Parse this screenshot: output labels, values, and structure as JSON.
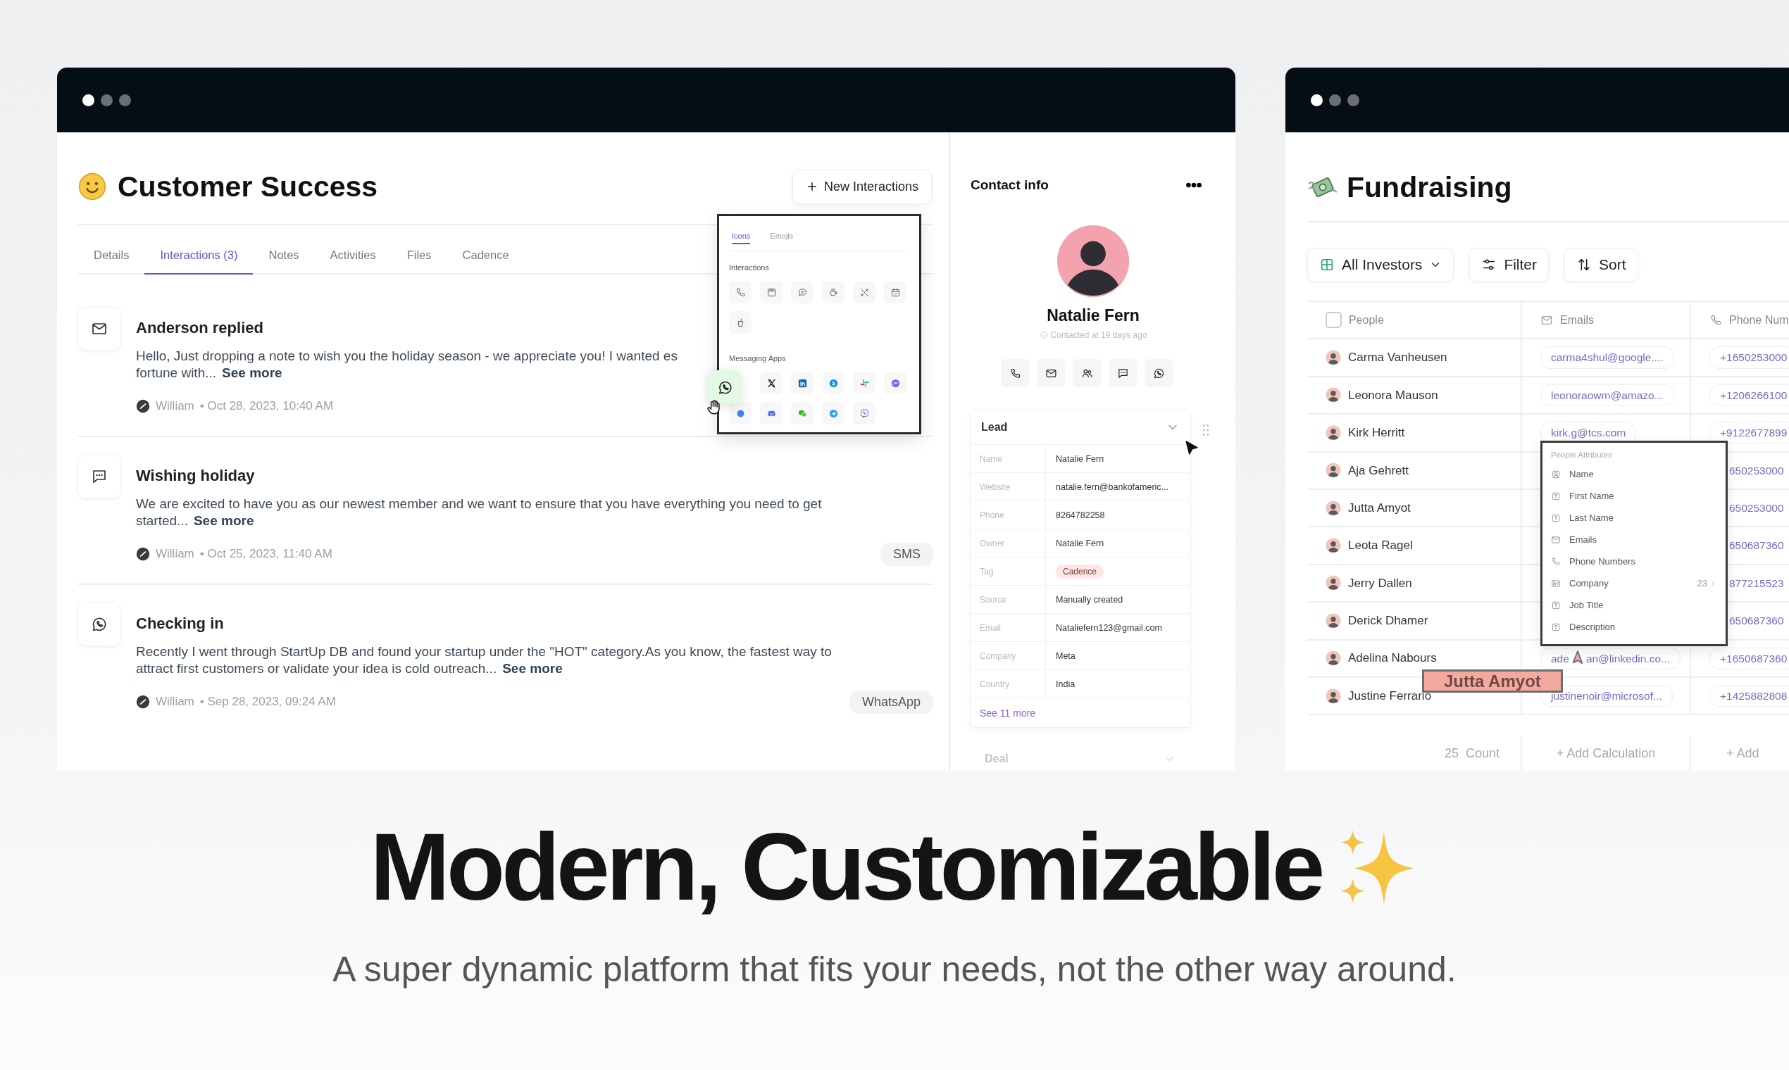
{
  "support_window": {
    "title": "Customer Success",
    "new_button": "New Interactions",
    "tabs": [
      {
        "label": "Details",
        "selected": false
      },
      {
        "label": "Interactions (3)",
        "selected": true
      },
      {
        "label": "Notes",
        "selected": false
      },
      {
        "label": "Activities",
        "selected": false
      },
      {
        "label": "Files",
        "selected": false
      },
      {
        "label": "Cadence",
        "selected": false
      }
    ],
    "interactions": [
      {
        "kind": "email",
        "title": "Anderson replied",
        "lines": [
          "Hello, Just dropping a note to wish you the holiday season - we appreciate you!  I wanted es",
          "fortune with..."
        ],
        "see_more": "See more",
        "author": "William",
        "date": "• Oct 28, 2023, 10:40 AM"
      },
      {
        "kind": "message",
        "title": "Wishing holiday",
        "lines": [
          "We are excited to have you as our newest member and we want to ensure that you have everything you need to get",
          "started..."
        ],
        "see_more": "See more",
        "author": "William",
        "date": "• Oct 25, 2023, 11:40 AM",
        "channel": "SMS"
      },
      {
        "kind": "whatsapp",
        "title": "Checking in",
        "lines": [
          "Recently I went through StartUp DB and found your startup under the \"HOT\" category.As you know, the fastest way to",
          "attract first customers or validate your idea is cold outreach..."
        ],
        "see_more": "See more",
        "author": "William",
        "date": "• Sep 28, 2023, 09:24 AM",
        "channel": "WhatsApp"
      }
    ],
    "icon_picker": {
      "tabs": [
        {
          "label": "Icons",
          "selected": true
        },
        {
          "label": "Emojis",
          "selected": false
        }
      ],
      "sections": [
        {
          "title": "Interactions",
          "icons": [
            {
              "kind": "phone",
              "dragging": false
            },
            {
              "kind": "window",
              "dragging": false
            },
            {
              "kind": "speech",
              "dragging": false
            },
            {
              "kind": "coffee",
              "dragging": false
            },
            {
              "kind": "utensils",
              "dragging": false
            },
            {
              "kind": "calendar",
              "dragging": false
            },
            {
              "kind": "cup",
              "dragging": false
            }
          ]
        },
        {
          "title": "Messaging Apps",
          "icons": [
            {
              "kind": "whatsapp",
              "dragging": true
            },
            {
              "kind": "xlogo",
              "dragging": false
            },
            {
              "kind": "linkedin",
              "dragging": false
            },
            {
              "kind": "skype",
              "dragging": false
            },
            {
              "kind": "slack",
              "dragging": false
            },
            {
              "kind": "messenger",
              "dragging": false
            },
            {
              "kind": "bubble",
              "dragging": false
            },
            {
              "kind": "discord",
              "dragging": false
            },
            {
              "kind": "wechat",
              "dragging": false
            },
            {
              "kind": "telegram",
              "dragging": false
            },
            {
              "kind": "viber",
              "dragging": false
            }
          ]
        }
      ]
    },
    "contact": {
      "title": "Contact info",
      "name": "Natalie Fern",
      "contacted": "Contacted at 19 days ago",
      "actions": [
        {
          "kind": "phone"
        },
        {
          "kind": "email"
        },
        {
          "kind": "people"
        },
        {
          "kind": "message"
        },
        {
          "kind": "whatsapp"
        }
      ],
      "lead": {
        "title": "Lead",
        "fields": [
          {
            "label": "Name",
            "value": "Natalie Fern",
            "kind": "text"
          },
          {
            "label": "Website",
            "value": "natalie.fern@bankofameric...",
            "kind": "text"
          },
          {
            "label": "Phone",
            "value": "8264782258",
            "kind": "text"
          },
          {
            "label": "Owner",
            "value": "Natalie Fern",
            "kind": "text"
          },
          {
            "label": "Tag",
            "value": "Cadence",
            "kind": "tag"
          },
          {
            "label": "Source",
            "value": "Manually created",
            "kind": "text"
          },
          {
            "label": "Email",
            "value": "Nataliefern123@gmail.com",
            "kind": "text"
          },
          {
            "label": "Company",
            "value": "Meta",
            "kind": "text"
          },
          {
            "label": "Country",
            "value": "India",
            "kind": "text"
          }
        ],
        "see_more": "See 11 more"
      },
      "deal": {
        "title": "Deal"
      }
    }
  },
  "fundraising_window": {
    "title": "Fundraising",
    "view_button": "All Investors",
    "filter_button": "Filter",
    "sort_button": "Sort",
    "select_all": {
      "checked": false
    },
    "columns": [
      "People",
      "Emails",
      "Phone Num"
    ],
    "rows": [
      {
        "name": "Carma Vanheusen",
        "email": "carma4shul@google....",
        "phone": "+1650253000"
      },
      {
        "name": "Leonora Mauson",
        "email": "leonoraowm@amazo...",
        "phone": "+1206266100"
      },
      {
        "name": "Kirk Herritt",
        "email": "kirk.g@tcs.com",
        "phone": "+9122677899"
      },
      {
        "name": "Aja Gehrett",
        "phone": "650253000"
      },
      {
        "name": "Jutta Amyot",
        "phone": "650253000"
      },
      {
        "name": "Leota Ragel",
        "phone": "650687360"
      },
      {
        "name": "Jerry Dallen",
        "phone": "877215523"
      },
      {
        "name": "Derick Dhamer",
        "phone": "650687360"
      },
      {
        "name": "Adelina Nabours",
        "email": "ade",
        "email_tail": "an@linkedin.co...",
        "phone": "+1650687360"
      },
      {
        "name": "Justine Ferrario",
        "email": "justinenoir@microsof...",
        "phone": "+1425882808"
      }
    ],
    "footer": {
      "count": "25",
      "count_label": "Count",
      "add_calculation": "+ Add Calculation",
      "add": "+ Add"
    },
    "attributes_menu": {
      "title": "People Attributes",
      "items": [
        {
          "kind": "person",
          "label": "Name"
        },
        {
          "kind": "text",
          "label": "First Name"
        },
        {
          "kind": "text",
          "label": "Last Name"
        },
        {
          "kind": "email",
          "label": "Emails"
        },
        {
          "kind": "phone",
          "label": "Phone Numbers"
        },
        {
          "kind": "company",
          "label": "Company",
          "count": "23"
        },
        {
          "kind": "text",
          "label": "Job Title"
        },
        {
          "kind": "text",
          "label": "Description"
        }
      ]
    },
    "drag_label": "Jutta Amyot"
  },
  "headline": {
    "title": "Modern, Customizable",
    "subtitle": "A super dynamic platform that fits your needs, not the other way around."
  }
}
